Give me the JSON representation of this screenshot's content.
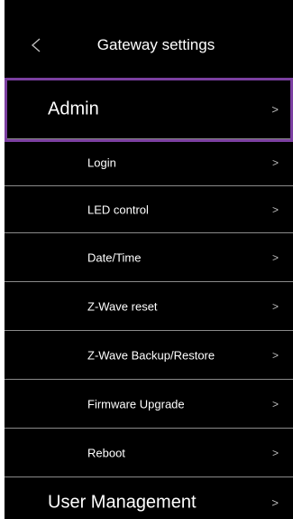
{
  "header": {
    "title": "Gateway settings",
    "back_icon": "chevron-left-icon"
  },
  "chevron": ">",
  "sections": [
    {
      "label": "Admin",
      "selected": true
    },
    {
      "label": "User Management",
      "selected": false
    }
  ],
  "admin_items": [
    {
      "label": "Login"
    },
    {
      "label": "LED control"
    },
    {
      "label": "Date/Time"
    },
    {
      "label": "Z-Wave reset"
    },
    {
      "label": "Z-Wave Backup/Restore"
    },
    {
      "label": "Firmware Upgrade"
    },
    {
      "label": "Reboot"
    }
  ],
  "colors": {
    "background": "#000000",
    "text": "#ffffff",
    "divider": "#8a8a8a",
    "highlight": "#7b3fa0"
  }
}
